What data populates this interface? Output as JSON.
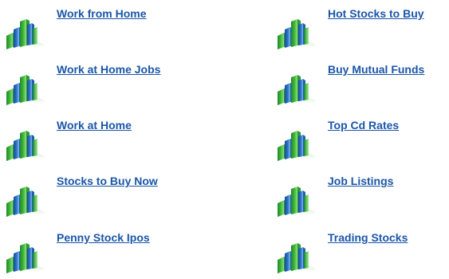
{
  "links": [
    {
      "label": "Work from Home"
    },
    {
      "label": "Hot Stocks to Buy"
    },
    {
      "label": "Work at Home Jobs"
    },
    {
      "label": "Buy Mutual Funds"
    },
    {
      "label": "Work at Home"
    },
    {
      "label": "Top Cd Rates"
    },
    {
      "label": "Stocks to Buy Now"
    },
    {
      "label": "Job Listings"
    },
    {
      "label": "Penny Stock Ipos"
    },
    {
      "label": "Trading Stocks"
    }
  ],
  "colors": {
    "link": "#1a56a8",
    "bar_green": "#3fb43a",
    "bar_blue": "#2a6fc4"
  },
  "icon": "bar-chart-icon"
}
